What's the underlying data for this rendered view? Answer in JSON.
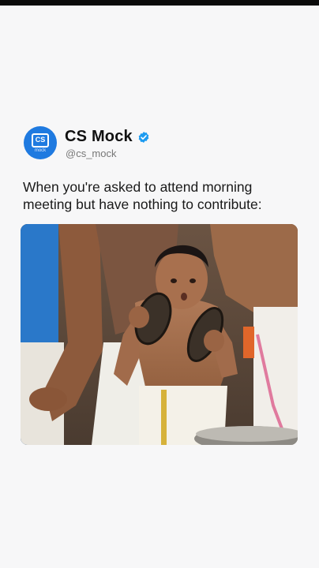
{
  "post": {
    "avatar": {
      "label": "CS",
      "sublabel": "mock"
    },
    "author_name": "CS Mock",
    "handle": "@cs_mock",
    "text": "When you're asked to attend morning meeting but have nothing to contribute:",
    "media_icon": "photo-meme-boy-with-cymbals"
  },
  "colors": {
    "avatar_bg": "#1f7ae0",
    "verified": "#1d9bf0",
    "background": "#f7f7f8"
  }
}
